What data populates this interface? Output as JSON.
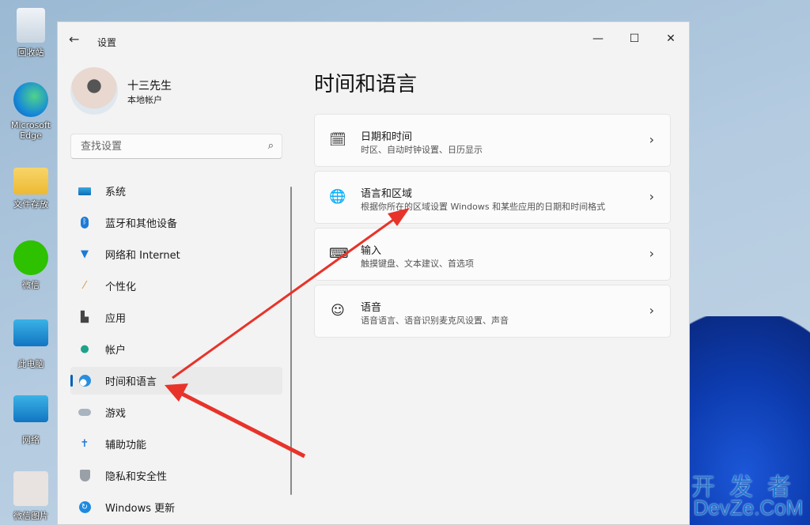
{
  "desktop": {
    "icons": [
      {
        "label": "回收站"
      },
      {
        "label": "Microsoft Edge"
      },
      {
        "label": "文件存放"
      },
      {
        "label": "微信"
      },
      {
        "label": "此电脑"
      },
      {
        "label": "网络"
      },
      {
        "label": "微信图片"
      }
    ]
  },
  "window": {
    "title": "设置",
    "minimize": "—",
    "maximize": "☐",
    "close": "✕",
    "back": "←"
  },
  "user": {
    "name": "十三先生",
    "type": "本地帐户"
  },
  "search": {
    "placeholder": "查找设置",
    "icon": "⌕"
  },
  "nav": [
    {
      "label": "系统",
      "icon": "system-icon"
    },
    {
      "label": "蓝牙和其他设备",
      "icon": "bluetooth-icon"
    },
    {
      "label": "网络和 Internet",
      "icon": "wifi-icon"
    },
    {
      "label": "个性化",
      "icon": "brush-icon"
    },
    {
      "label": "应用",
      "icon": "apps-icon"
    },
    {
      "label": "帐户",
      "icon": "account-icon"
    },
    {
      "label": "时间和语言",
      "icon": "time-language-icon",
      "selected": true
    },
    {
      "label": "游戏",
      "icon": "gamepad-icon"
    },
    {
      "label": "辅助功能",
      "icon": "accessibility-icon"
    },
    {
      "label": "隐私和安全性",
      "icon": "shield-icon"
    },
    {
      "label": "Windows 更新",
      "icon": "update-icon"
    }
  ],
  "main": {
    "title": "时间和语言",
    "cards": [
      {
        "title": "日期和时间",
        "subtitle": "时区、自动时钟设置、日历显示",
        "icon": "calendar-clock-icon"
      },
      {
        "title": "语言和区域",
        "subtitle": "根据你所在的区域设置 Windows 和某些应用的日期和时间格式",
        "icon": "language-icon"
      },
      {
        "title": "输入",
        "subtitle": "触摸键盘、文本建议、首选项",
        "icon": "keyboard-icon"
      },
      {
        "title": "语音",
        "subtitle": "语音语言、语音识别麦克风设置、声音",
        "icon": "speech-icon"
      }
    ]
  },
  "watermark": {
    "line1": "开发者",
    "line2": "DevZe.CoM"
  },
  "colors": {
    "accent": "#005fb8",
    "arrow": "#e8332a"
  }
}
